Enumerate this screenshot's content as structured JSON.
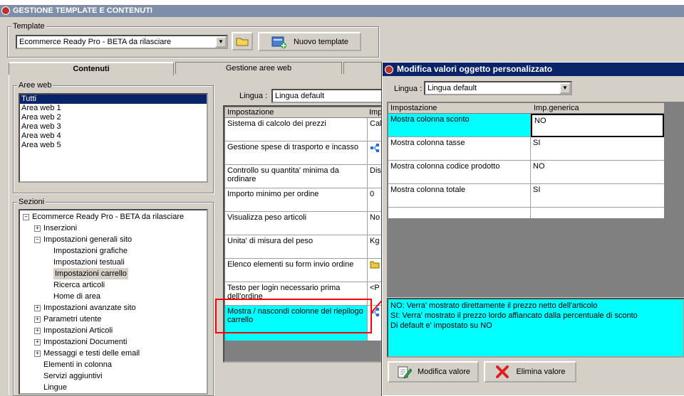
{
  "window": {
    "title": "GESTIONE TEMPLATE E CONTENUTI"
  },
  "template": {
    "group_label": "Template",
    "selected": "Ecommerce Ready Pro - BETA da rilasciare",
    "new_button": "Nuovo template"
  },
  "tabs": [
    {
      "label": "Contenuti"
    },
    {
      "label": "Gestione aree web"
    }
  ],
  "aree_web": {
    "label": "Aree web",
    "items": [
      "Tutti",
      "Area web 1",
      "Area web 2",
      "Area web 3",
      "Area web 4",
      "Area web 5"
    ]
  },
  "sezioni": {
    "label": "Sezioni",
    "nodes": [
      {
        "text": "Ecommerce Ready Pro - BETA da rilasciare",
        "expander": "−"
      },
      {
        "text": "Inserzioni",
        "expander": "+"
      },
      {
        "text": "Impostazioni generali sito",
        "expander": "−"
      },
      {
        "text": "Impostazioni grafiche",
        "expander": ""
      },
      {
        "text": "Impostazioni testuali",
        "expander": ""
      },
      {
        "text": "Impostazioni carrello",
        "expander": ""
      },
      {
        "text": "Ricerca articoli",
        "expander": ""
      },
      {
        "text": "Home di area",
        "expander": ""
      },
      {
        "text": "Impostazioni avanzate sito",
        "expander": "+"
      },
      {
        "text": "Parametri utente",
        "expander": "+"
      },
      {
        "text": "Impostazioni Articoli",
        "expander": "+"
      },
      {
        "text": "Impostazioni Documenti",
        "expander": "+"
      },
      {
        "text": "Messaggi e testi delle email",
        "expander": "+"
      },
      {
        "text": "Elementi in colonna",
        "expander": ""
      },
      {
        "text": "Servizi aggiuntivi",
        "expander": ""
      },
      {
        "text": "Lingue",
        "expander": ""
      }
    ]
  },
  "lingua": {
    "label": "Lingua :",
    "selected": "Lingua default"
  },
  "settings_grid": {
    "headers": [
      "Impostazione",
      "Imp"
    ],
    "rows": [
      {
        "name": "Sistema di calcolo dei prezzi",
        "value": "Cal"
      },
      {
        "name": "Gestione spese di trasporto e incasso",
        "value": ""
      },
      {
        "name": "Controllo su quantita' minima da ordinare",
        "value": "Dis"
      },
      {
        "name": "Importo minimo per ordine",
        "value": "0"
      },
      {
        "name": "Visualizza peso articoli",
        "value": "No"
      },
      {
        "name": "Unita' di misura del peso",
        "value": "Kg"
      },
      {
        "name": "Elenco elementi su form invio ordine",
        "value": ""
      },
      {
        "name": "Testo per login necessario prima dell'ordine",
        "value": "<P"
      },
      {
        "name": "Mostra / nascondi colonne del riepilogo carrello",
        "value": ""
      }
    ]
  },
  "dialog": {
    "title": "Modifica valori oggetto personalizzato",
    "lingua_label": "Lingua :",
    "lingua_selected": "Lingua default",
    "headers": [
      "Impostazione",
      "Imp.generica"
    ],
    "rows": [
      {
        "name": "Mostra colonna sconto",
        "value": "NO"
      },
      {
        "name": "Mostra colonna tasse",
        "value": "SI"
      },
      {
        "name": "Mostra colonna codice prodotto",
        "value": "NO"
      },
      {
        "name": "Mostra colonna totale",
        "value": "SI"
      }
    ],
    "description": [
      "NO: Verra' mostrato direttamente il prezzo netto dell'articolo",
      "SI: Verra' mostrato il prezzo lordo affiancato dalla percentuale di sconto",
      "Di default e' impostato su NO"
    ],
    "edit_button": "Modifica valore",
    "delete_button": "Elimina valore"
  },
  "colors": {
    "highlight": "#00ffff",
    "annotation": "#ff0000",
    "title_bar": "#0a246a",
    "selection": "#0a246a"
  }
}
